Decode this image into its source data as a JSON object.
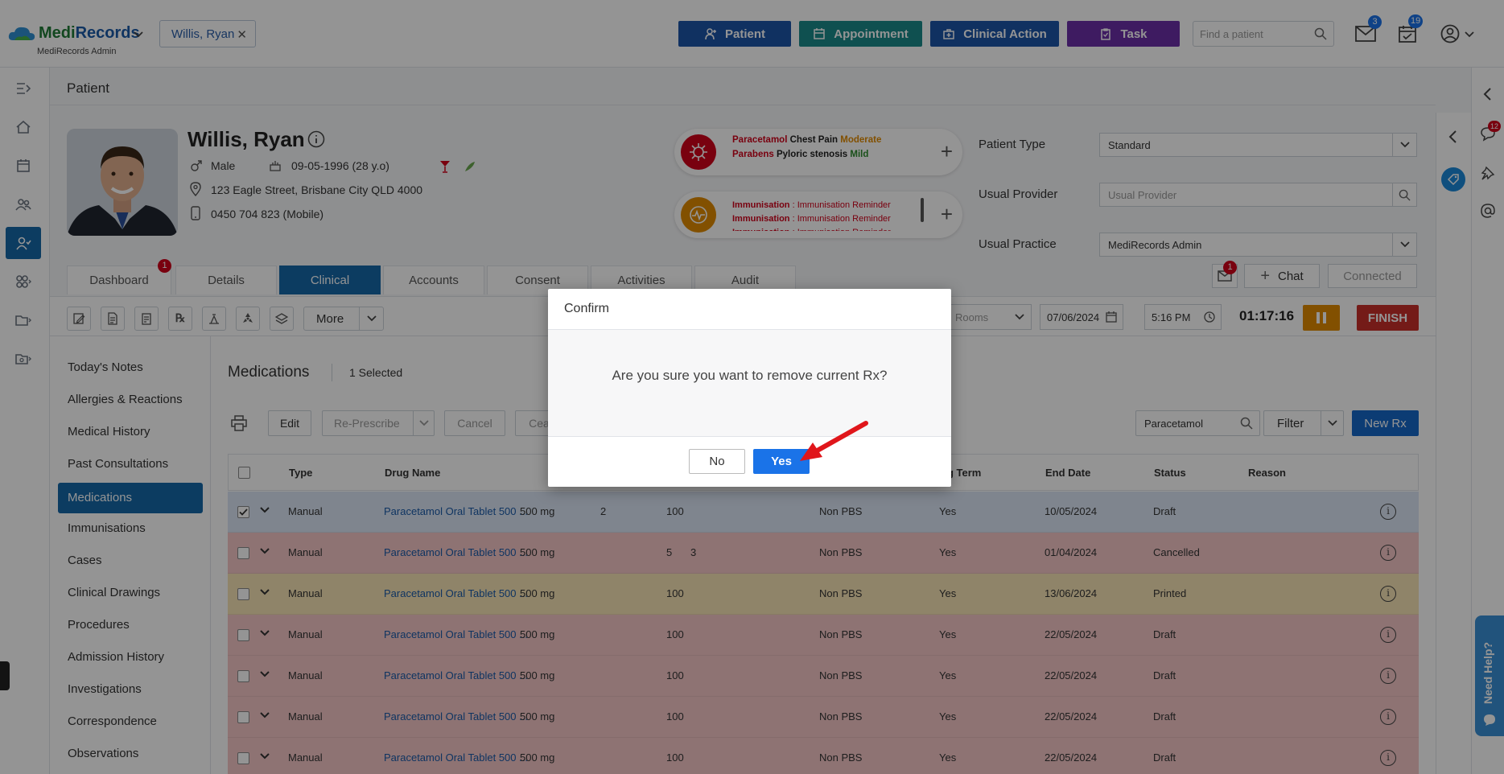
{
  "app": {
    "brand_a": "Medi",
    "brand_b": "Records",
    "sub": "MediRecords Admin"
  },
  "topbar": {
    "patient_chip": "Willis, Ryan",
    "buttons": [
      {
        "label": "Patient",
        "color": "#1d55a8"
      },
      {
        "label": "Appointment",
        "color": "#1b8a8a"
      },
      {
        "label": "Clinical Action",
        "color": "#1d55a8"
      },
      {
        "label": "Task",
        "color": "#6b2fa8"
      }
    ],
    "search_placeholder": "Find a patient",
    "mail_count": "3",
    "tasks_count": "19"
  },
  "page": {
    "title": "Patient"
  },
  "patient": {
    "name": "Willis, Ryan",
    "gender": "Male",
    "dob": "09-05-1996 (28 y.o)",
    "address": "123 Eagle Street, Brisbane City QLD 4000",
    "phone": "0450 704 823 (Mobile)"
  },
  "allergy": {
    "row1": {
      "drug": "Paracetamol",
      "reaction": "Chest Pain",
      "severity": "Moderate"
    },
    "row2": {
      "drug": "Parabens",
      "reaction": "Pyloric stenosis",
      "severity": "Mild"
    }
  },
  "immunisation": {
    "label": "Immunisation",
    "text": "Immunisation Reminder"
  },
  "fields": {
    "patient_type": {
      "label": "Patient Type",
      "value": "Standard"
    },
    "usual_provider": {
      "label": "Usual Provider",
      "placeholder": "Usual Provider"
    },
    "usual_practice": {
      "label": "Usual Practice",
      "value": "MediRecords Admin"
    }
  },
  "tabs": [
    "Dashboard",
    "Details",
    "Clinical",
    "Accounts",
    "Consent",
    "Activities",
    "Audit"
  ],
  "tab_badge": "1",
  "chat": {
    "badge": "1",
    "chat_label": "Chat",
    "connected_label": "Connected"
  },
  "toolbar": {
    "more_label": "More",
    "rooms_placeholder": "Rooms",
    "date": "07/06/2024",
    "time": "5:16 PM",
    "timer": "01:17:16",
    "finish_label": "FINISH"
  },
  "sidenav": [
    "Today's Notes",
    "Allergies & Reactions",
    "Medical History",
    "Past Consultations",
    "Medications",
    "Immunisations",
    "Cases",
    "Clinical Drawings",
    "Procedures",
    "Admission History",
    "Investigations",
    "Correspondence",
    "Observations"
  ],
  "medications": {
    "title": "Medications",
    "selected": "1 Selected",
    "actions": {
      "edit": "Edit",
      "represcribe": "Re-Prescribe",
      "cancel": "Cancel",
      "cease": "Cea"
    },
    "search_value": "Paracetamol",
    "filter_label": "Filter",
    "new_rx_label": "New Rx",
    "headers": {
      "type": "Type",
      "drug": "Drug Name",
      "long_term": "ng Term",
      "end_date": "End Date",
      "status": "Status",
      "reason": "Reason"
    },
    "rows": [
      {
        "type": "Manual",
        "drug": "Paracetamol Oral Tablet 500 ...",
        "strength": "500 mg",
        "repeats": "2",
        "qty": "100",
        "extra": "",
        "pbs": "Non PBS",
        "long": "Yes",
        "end": "10/05/2024",
        "status": "Draft",
        "bg": "#dbe6f5",
        "checked": true
      },
      {
        "type": "Manual",
        "drug": "Paracetamol Oral Tablet 500 ...",
        "strength": "500 mg",
        "repeats": "",
        "qty": "5",
        "extra": "3",
        "pbs": "Non PBS",
        "long": "Yes",
        "end": "01/04/2024",
        "status": "Cancelled",
        "bg": "#f4c7c7",
        "checked": false
      },
      {
        "type": "Manual",
        "drug": "Paracetamol Oral Tablet 500 ...",
        "strength": "500 mg",
        "repeats": "",
        "qty": "100",
        "extra": "",
        "pbs": "Non PBS",
        "long": "Yes",
        "end": "13/06/2024",
        "status": "Printed",
        "bg": "#f7e3b5",
        "checked": false
      },
      {
        "type": "Manual",
        "drug": "Paracetamol Oral Tablet 500 ...",
        "strength": "500 mg",
        "repeats": "",
        "qty": "100",
        "extra": "",
        "pbs": "Non PBS",
        "long": "Yes",
        "end": "22/05/2024",
        "status": "Draft",
        "bg": "#f4c7c7",
        "checked": false
      },
      {
        "type": "Manual",
        "drug": "Paracetamol Oral Tablet 500 ...",
        "strength": "500 mg",
        "repeats": "",
        "qty": "100",
        "extra": "",
        "pbs": "Non PBS",
        "long": "Yes",
        "end": "22/05/2024",
        "status": "Draft",
        "bg": "#f4c7c7",
        "checked": false
      },
      {
        "type": "Manual",
        "drug": "Paracetamol Oral Tablet 500 ...",
        "strength": "500 mg",
        "repeats": "",
        "qty": "100",
        "extra": "",
        "pbs": "Non PBS",
        "long": "Yes",
        "end": "22/05/2024",
        "status": "Draft",
        "bg": "#f4c7c7",
        "checked": false
      },
      {
        "type": "Manual",
        "drug": "Paracetamol Oral Tablet 500 ...",
        "strength": "500 mg",
        "repeats": "",
        "qty": "100",
        "extra": "",
        "pbs": "Non PBS",
        "long": "Yes",
        "end": "22/05/2024",
        "status": "Draft",
        "bg": "#f4c7c7",
        "checked": false
      }
    ]
  },
  "dialog": {
    "title": "Confirm",
    "message": "Are you sure you want to remove current Rx?",
    "no_label": "No",
    "yes_label": "Yes"
  },
  "rightrail": {
    "chat_badge": "12"
  },
  "help_label": "Need Help?"
}
